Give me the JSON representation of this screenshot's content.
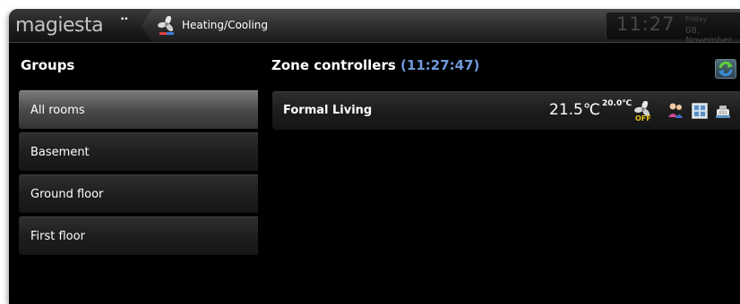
{
  "app": {
    "logo": "magiesta",
    "logo_dots": "••"
  },
  "header": {
    "breadcrumb_label": "Heating/Cooling",
    "breadcrumb_icon": "fan-icon",
    "clock": {
      "time": "11:27",
      "day": "Friday",
      "date": "08. November"
    }
  },
  "groups": {
    "title": "Groups",
    "items": [
      {
        "label": "All rooms",
        "active": true
      },
      {
        "label": "Basement",
        "active": false
      },
      {
        "label": "Ground floor",
        "active": false
      },
      {
        "label": "First floor",
        "active": false
      }
    ]
  },
  "zone_panel": {
    "title": "Zone controllers",
    "timestamp": "(11:27:47)",
    "refresh_icon": "refresh-icon",
    "rows": [
      {
        "name": "Formal Living",
        "temperature": "21.5℃",
        "setpoint": "20.0℃",
        "fan_state": "OFF",
        "icons": [
          "fan-icon",
          "persons-icon",
          "window-icon",
          "heater-icon"
        ]
      }
    ]
  },
  "colors": {
    "background": "#000000",
    "accent_time": "#6f99d9",
    "off_label": "#e6c21b",
    "clock": "#474747"
  }
}
